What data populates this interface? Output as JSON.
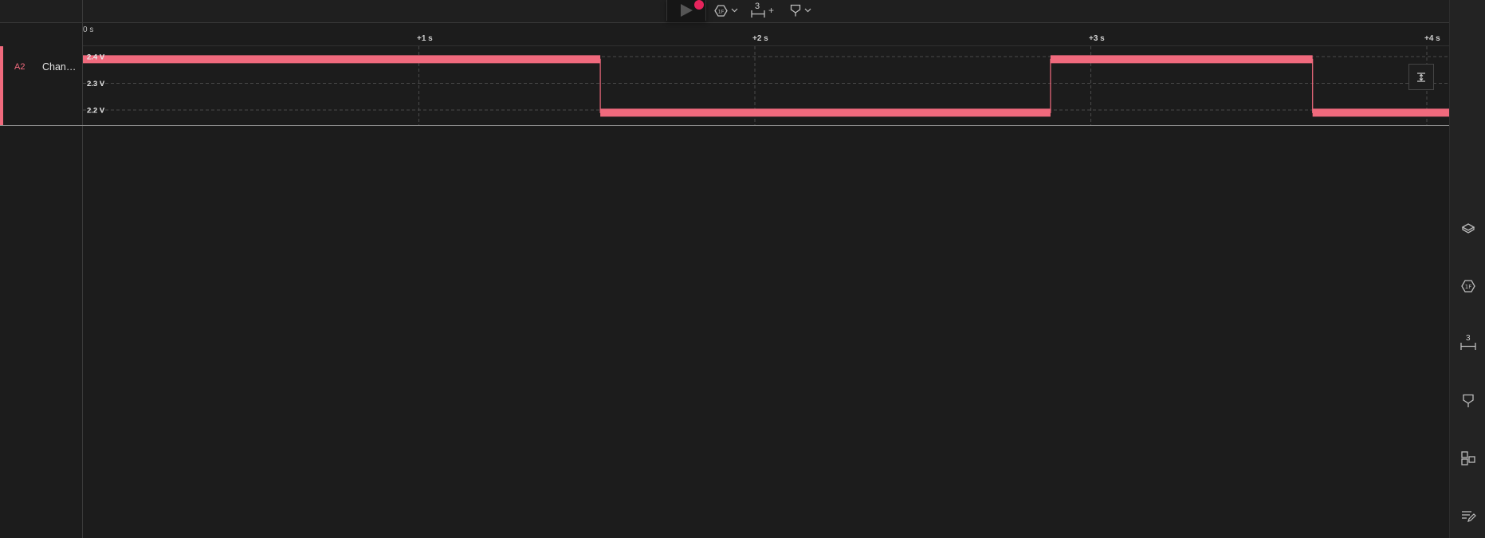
{
  "channel": {
    "id": "A2",
    "name": "Chan…",
    "color": "#f06a7d"
  },
  "time_ruler": {
    "origin_label": "0 s",
    "ticks": [
      "+1 s",
      "+2 s",
      "+3 s",
      "+4 s"
    ]
  },
  "voltage_axis": {
    "labels": [
      "2.4 V",
      "2.3 V",
      "2.2 V"
    ]
  },
  "toolbar": {
    "measure_count": "3",
    "add_symbol": "+"
  },
  "sidebar": {
    "measure_count": "3"
  },
  "chart_data": {
    "type": "line",
    "x": [
      0,
      1.54,
      1.54,
      2.88,
      2.88,
      3.66,
      3.66,
      4.07
    ],
    "series": [
      {
        "values": [
          2.39,
          2.39,
          2.19,
          2.19,
          2.39,
          2.39,
          2.19,
          2.19
        ]
      }
    ],
    "xlim": [
      0,
      4.07
    ],
    "ylim": [
      2.17,
      2.43
    ],
    "x_ticks": [
      "+1 s",
      "+2 s",
      "+3 s",
      "+4 s"
    ],
    "y_ticks": [
      "2.4 V",
      "2.3 V",
      "2.2 V"
    ],
    "grid": true
  }
}
